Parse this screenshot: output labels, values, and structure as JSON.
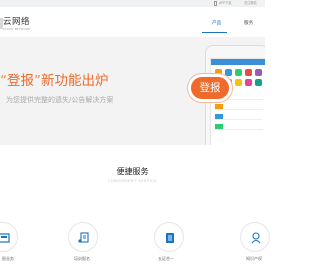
{
  "topbar": {
    "app_label": "APP下载",
    "wechat_label": "关注微信"
  },
  "header": {
    "logo_text": "云网络",
    "logo_sub": "CLOUD NETWORK",
    "nav": [
      {
        "label": "产品",
        "active": true
      },
      {
        "label": "服务",
        "active": false
      }
    ],
    "accent": "#1a73c7"
  },
  "banner": {
    "headline_quote": "“",
    "headline_key": "登报",
    "headline_quote_close": "”",
    "headline_rest": "新功能出炉",
    "subline": "为您提供完整的遗失/公告解决方案",
    "badge": "登报",
    "accent": "#ef6a2b",
    "slides_total": 3,
    "slide_active": 1
  },
  "services": {
    "title": "便捷服务",
    "subtitle": "CONVENIENT SERVICE",
    "items": [
      {
        "label": "报业务",
        "icon": "newspaper-icon"
      },
      {
        "label": "培训报名",
        "icon": "training-icon"
      },
      {
        "label": "五证合一",
        "icon": "document-icon"
      },
      {
        "label": "知识产权",
        "icon": "ip-icon"
      }
    ]
  }
}
